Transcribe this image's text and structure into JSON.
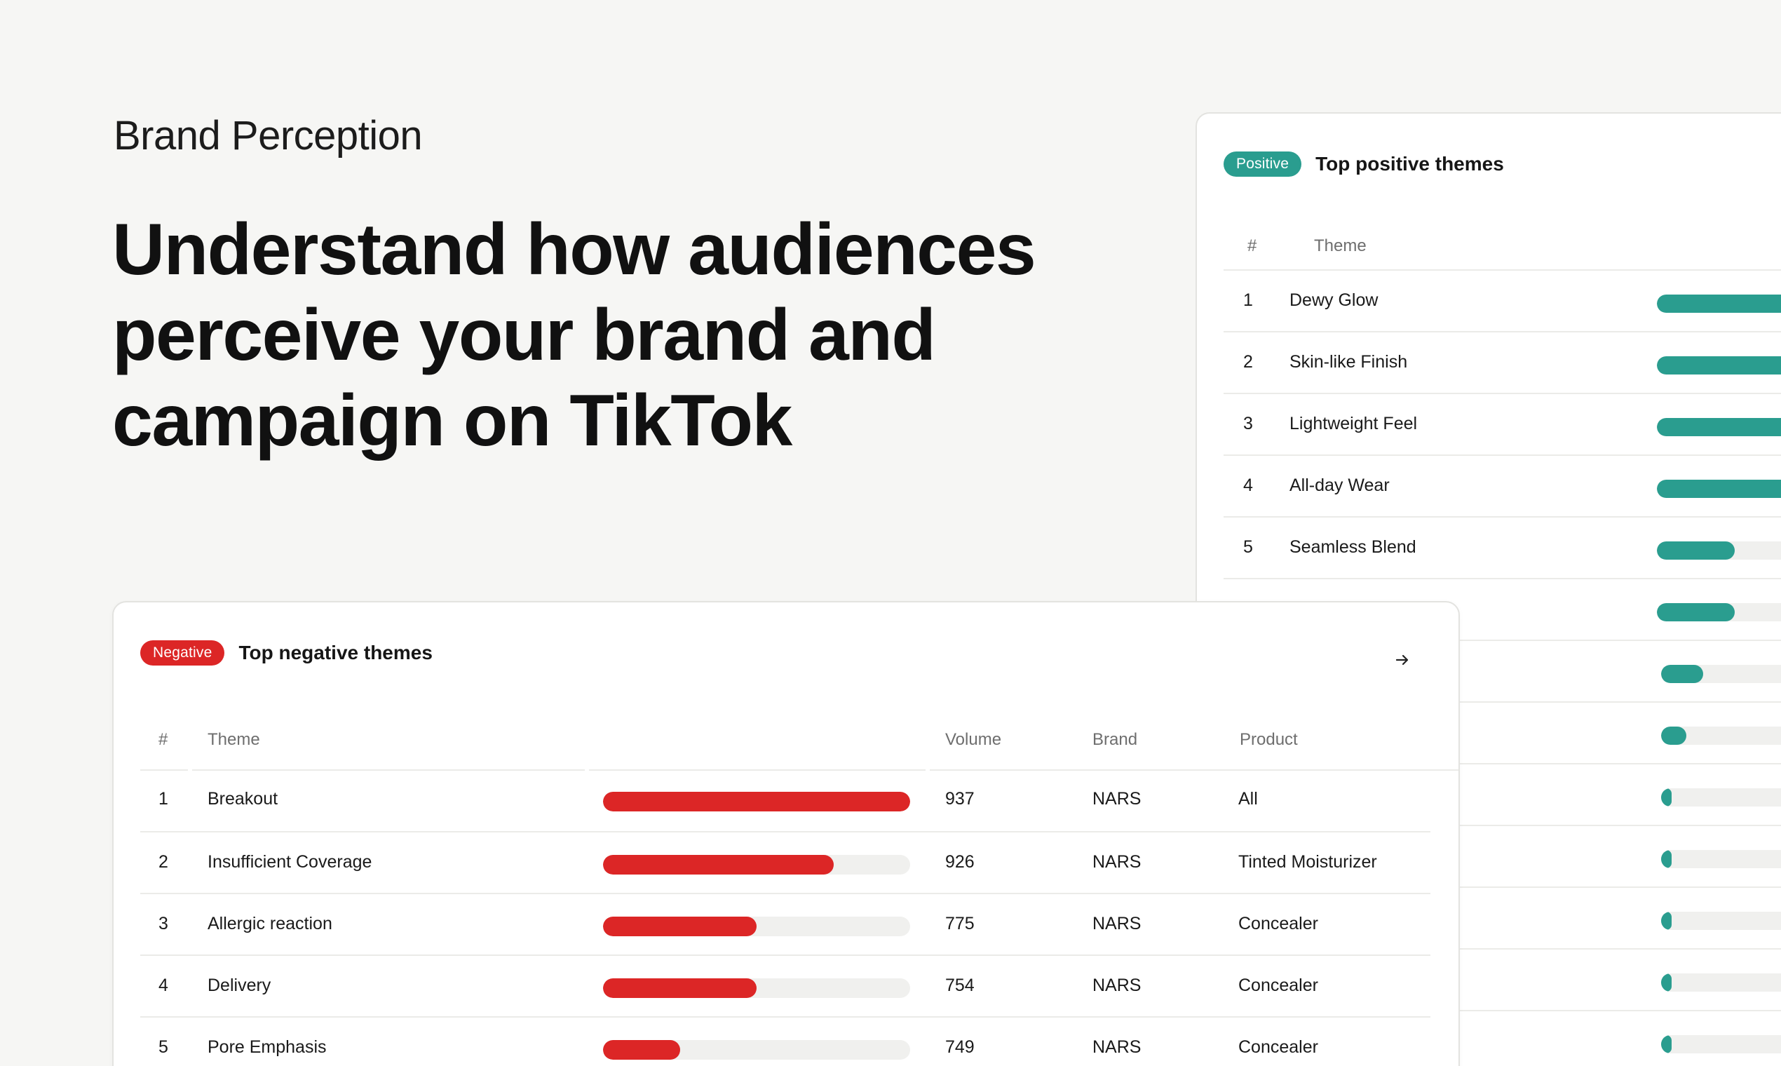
{
  "hero": {
    "eyebrow": "Brand Perception",
    "headline_lines": [
      "Understand how audiences",
      "perceive your brand and",
      "campaign on TikTok"
    ]
  },
  "positive_card": {
    "badge": "Positive",
    "title": "Top positive themes",
    "columns": {
      "number": "#",
      "theme": "Theme"
    },
    "rows": [
      {
        "rank": "1",
        "theme": "Dewy Glow",
        "level": 1.0
      },
      {
        "rank": "2",
        "theme": "Skin-like Finish",
        "level": 1.0
      },
      {
        "rank": "3",
        "theme": "Lightweight Feel",
        "level": 1.0
      },
      {
        "rank": "4",
        "theme": "All-day Wear",
        "level": 1.0
      },
      {
        "rank": "5",
        "theme": "Seamless Blend",
        "level": 0.37
      },
      {
        "rank": "",
        "theme": "",
        "level": 0.37
      },
      {
        "rank": "",
        "theme": "",
        "level": 0.2
      },
      {
        "rank": "",
        "theme": "",
        "level": 0.12
      },
      {
        "rank": "",
        "theme": "",
        "level": 0.05
      },
      {
        "rank": "",
        "theme": "",
        "level": 0.05
      },
      {
        "rank": "",
        "theme": "",
        "level": 0.05
      },
      {
        "rank": "",
        "theme": "",
        "level": 0.05
      },
      {
        "rank": "",
        "theme": "",
        "level": 0.05
      }
    ],
    "accent": "#2a9d8f"
  },
  "negative_card": {
    "badge": "Negative",
    "title": "Top negative themes",
    "columns": {
      "number": "#",
      "theme": "Theme",
      "volume": "Volume",
      "brand": "Brand",
      "product": "Product"
    },
    "rows": [
      {
        "rank": "1",
        "theme": "Breakout",
        "level": 1.0,
        "volume": "937",
        "brand": "NARS",
        "product": "All"
      },
      {
        "rank": "2",
        "theme": "Insufficient Coverage",
        "level": 0.75,
        "volume": "926",
        "brand": "NARS",
        "product": "Tinted Moisturizer"
      },
      {
        "rank": "3",
        "theme": "Allergic reaction",
        "level": 0.5,
        "volume": "775",
        "brand": "NARS",
        "product": "Concealer"
      },
      {
        "rank": "4",
        "theme": "Delivery",
        "level": 0.5,
        "volume": "754",
        "brand": "NARS",
        "product": "Concealer"
      },
      {
        "rank": "5",
        "theme": "Pore Emphasis",
        "level": 0.25,
        "volume": "749",
        "brand": "NARS",
        "product": "Concealer"
      }
    ],
    "accent": "#dc2626"
  }
}
